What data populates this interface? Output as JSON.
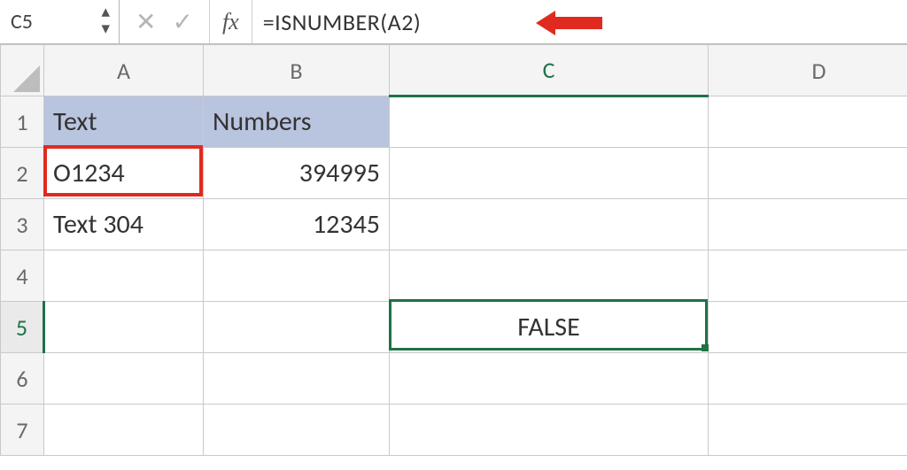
{
  "name_box": "C5",
  "formula": "=ISNUMBER(A2)",
  "fx_label": "fx",
  "col_headers": [
    "A",
    "B",
    "C",
    "D"
  ],
  "row_headers": [
    "1",
    "2",
    "3",
    "4",
    "5",
    "6",
    "7"
  ],
  "cells": {
    "A1": "Text",
    "B1": "Numbers",
    "A2": "O1234",
    "B2": "394995",
    "A3": "Text 304",
    "B3": "12345",
    "C5": "FALSE"
  },
  "active_cell": "C5",
  "highlighted_cell": "A2",
  "colors": {
    "selection": "#1f7246",
    "callout": "#e12a1f",
    "header_fill": "#b9c4de"
  }
}
